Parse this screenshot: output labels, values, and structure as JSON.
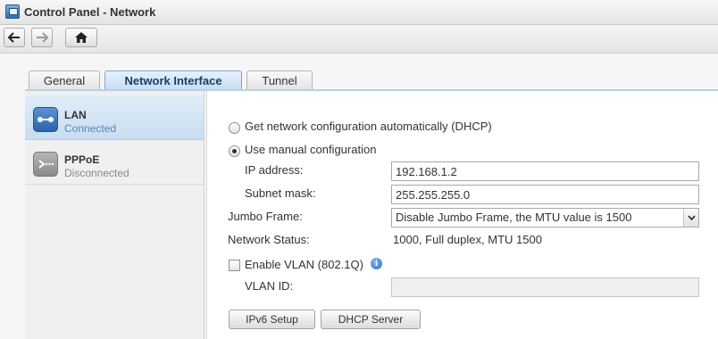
{
  "window": {
    "title": "Control Panel - Network"
  },
  "toolbar": {
    "back_icon": "arrow-left-icon",
    "forward_icon": "arrow-right-icon",
    "home_icon": "home-icon"
  },
  "tabs": [
    {
      "label": "General",
      "active": false
    },
    {
      "label": "Network Interface",
      "active": true
    },
    {
      "label": "Tunnel",
      "active": false
    }
  ],
  "interfaces": [
    {
      "name": "LAN",
      "status": "Connected",
      "selected": true,
      "icon": "lan-icon"
    },
    {
      "name": "PPPoE",
      "status": "Disconnected",
      "selected": false,
      "icon": "pppoe-icon"
    }
  ],
  "form": {
    "dhcp_label": "Get network configuration automatically (DHCP)",
    "manual_label": "Use manual configuration",
    "mode": "manual",
    "ip_label": "IP address:",
    "ip_value": "192.168.1.2",
    "subnet_label": "Subnet mask:",
    "subnet_value": "255.255.255.0",
    "jumbo_label": "Jumbo Frame:",
    "jumbo_value": "Disable Jumbo Frame, the MTU value is 1500",
    "status_label": "Network Status:",
    "status_value": "1000, Full duplex, MTU 1500",
    "vlan_label": "Enable VLAN (802.1Q)",
    "vlan_checked": false,
    "vlan_id_label": "VLAN ID:",
    "vlan_id_value": "",
    "ipv6_button": "IPv6 Setup",
    "dhcp_server_button": "DHCP Server"
  },
  "colors": {
    "accent": "#2a63ab",
    "tab_active_text": "#1a3f66",
    "selected_row": "#c8ddf1"
  }
}
